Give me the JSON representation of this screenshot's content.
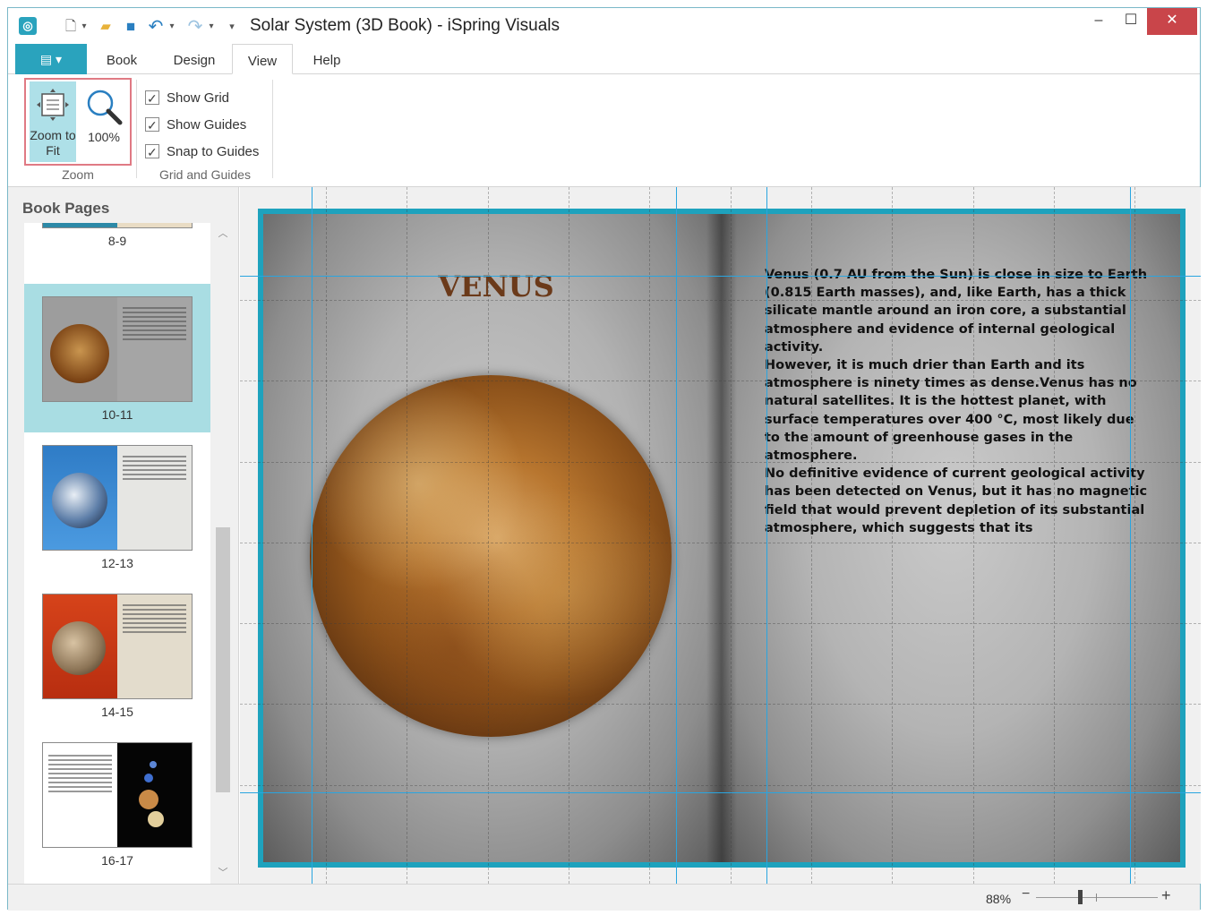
{
  "window": {
    "title": "Solar System (3D Book) - iSpring Visuals",
    "minimize": "–",
    "maximize": "☐",
    "close": "✕"
  },
  "quick_access": {
    "new_icon": "🗋",
    "open_icon": "📂",
    "save_icon": "💾",
    "undo_icon": "↶",
    "redo_icon": "↷",
    "dropdown_icon": "▾"
  },
  "ribbon": {
    "file_tab": "▤ ▾",
    "tabs": [
      "Book",
      "Design",
      "View",
      "Help"
    ],
    "active_tab": "View",
    "zoom_group": {
      "zoom_to_fit_label": "Zoom to Fit",
      "zoom_100_label": "100%",
      "group_label": "Zoom"
    },
    "grid_group": {
      "show_grid": "Show Grid",
      "show_guides": "Show Guides",
      "snap_to_guides": "Snap to Guides",
      "group_label": "Grid and Guides"
    }
  },
  "sidebar": {
    "title": "Book Pages",
    "pages": [
      {
        "label": "8-9"
      },
      {
        "label": "10-11",
        "selected": true
      },
      {
        "label": "12-13"
      },
      {
        "label": "14-15"
      },
      {
        "label": "16-17"
      }
    ]
  },
  "book": {
    "left_title": "VENUS",
    "right_text": "Venus (0.7 AU from the Sun) is close in size to Earth (0.815 Earth masses), and, like Earth, has a thick silicate mantle around an iron core, a substantial atmosphere and evidence of internal geological activity.\nHowever, it is much drier than Earth and its atmosphere is ninety times as dense.Venus has no natural satellites. It is the hottest planet, with surface temperatures over 400 °C, most likely due to the amount of greenhouse gases in the atmosphere.\nNo definitive evidence of current geological activity has been detected on Venus, but it has no magnetic field that would prevent depletion of its substantial atmosphere, which suggests that its",
    "border_color": "#1ea2bd",
    "guide_color": "#29a5e0"
  },
  "statusbar": {
    "zoom": "88%",
    "zoom_minus": "−",
    "zoom_plus": "+"
  }
}
